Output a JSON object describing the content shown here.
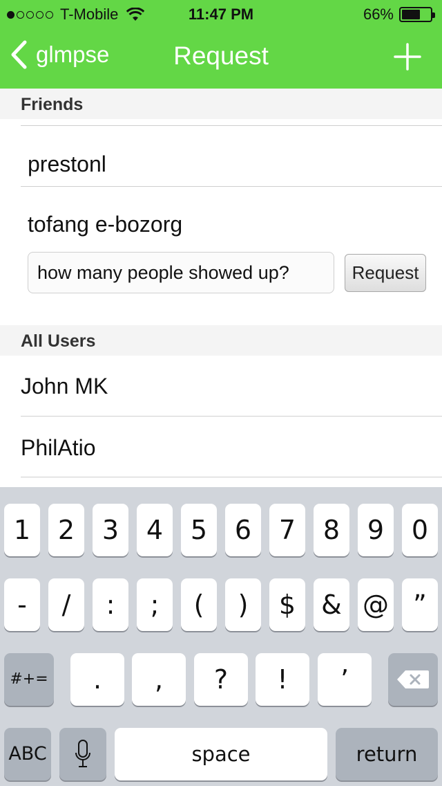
{
  "status": {
    "carrier": "T-Mobile",
    "time": "11:47 PM",
    "battery": "66%",
    "battery_level": 0.66,
    "signal_bars": 1
  },
  "nav": {
    "back_label": "glmpse",
    "title": "Request"
  },
  "friends": {
    "header": "Friends",
    "items": [
      {
        "name": "prestonl"
      },
      {
        "name": "tofang e-bozorg"
      }
    ],
    "request_input_value": "how many people showed up?",
    "request_button": "Request"
  },
  "all_users": {
    "header": "All Users",
    "items": [
      {
        "name": "John MK"
      },
      {
        "name": "PhilAtio"
      }
    ]
  },
  "keyboard": {
    "row1": [
      "1",
      "2",
      "3",
      "4",
      "5",
      "6",
      "7",
      "8",
      "9",
      "0"
    ],
    "row2": [
      "-",
      "/",
      ":",
      ";",
      "(",
      ")",
      "$",
      "&",
      "@",
      "”"
    ],
    "row3_left": "#+=",
    "row3": [
      ".",
      ",",
      "?",
      "!",
      "’"
    ],
    "abc": "ABC",
    "space": "space",
    "return": "return"
  },
  "colors": {
    "header_green": "#63d746",
    "keyboard_bg": "#d1d5db"
  }
}
